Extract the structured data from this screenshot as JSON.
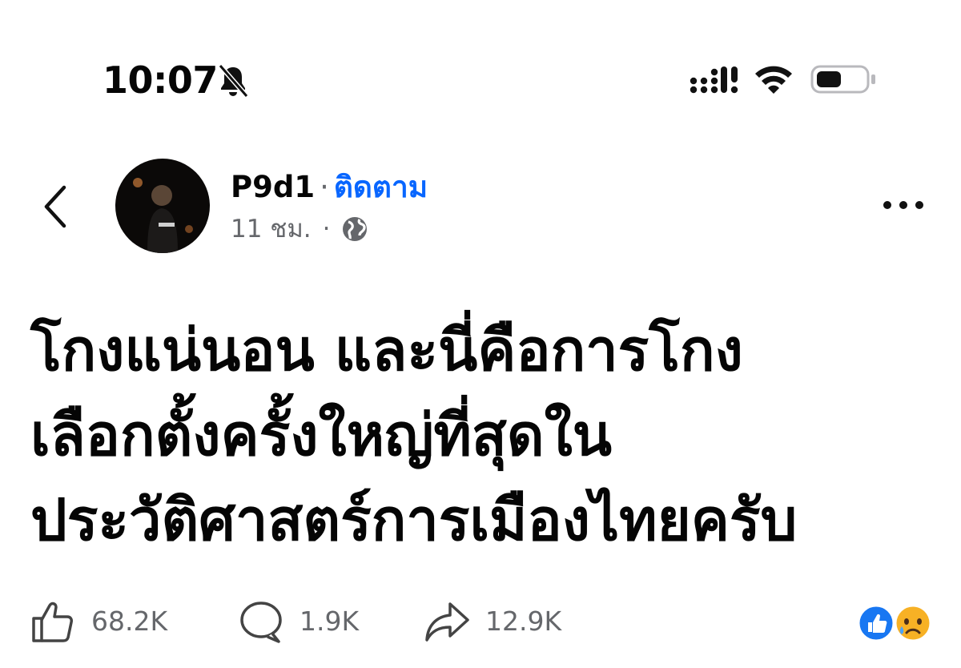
{
  "status_bar": {
    "time": "10:07",
    "icons": [
      "bell-slash-icon",
      "signal-icon",
      "wifi-icon",
      "battery-icon"
    ]
  },
  "post": {
    "author": "P9d1",
    "separator": "·",
    "follow_label": "ติดตาม",
    "timestamp": "11 ชม.",
    "meta_separator": "·",
    "privacy_icon": "globe-icon",
    "text_lines": [
      "โกงแน่นอน และนี่คือการโกง",
      "เลือกตั้งครั้งใหญ่ที่สุดใน",
      "ประวัติศาสตร์การเมืองไทยครับ"
    ]
  },
  "actions": {
    "likes": "68.2K",
    "comments": "1.9K",
    "shares": "12.9K"
  },
  "reactions": [
    "like-icon",
    "sad-icon"
  ],
  "colors": {
    "link_blue": "#0866ff",
    "meta_gray": "#65676b",
    "text": "#050505"
  }
}
